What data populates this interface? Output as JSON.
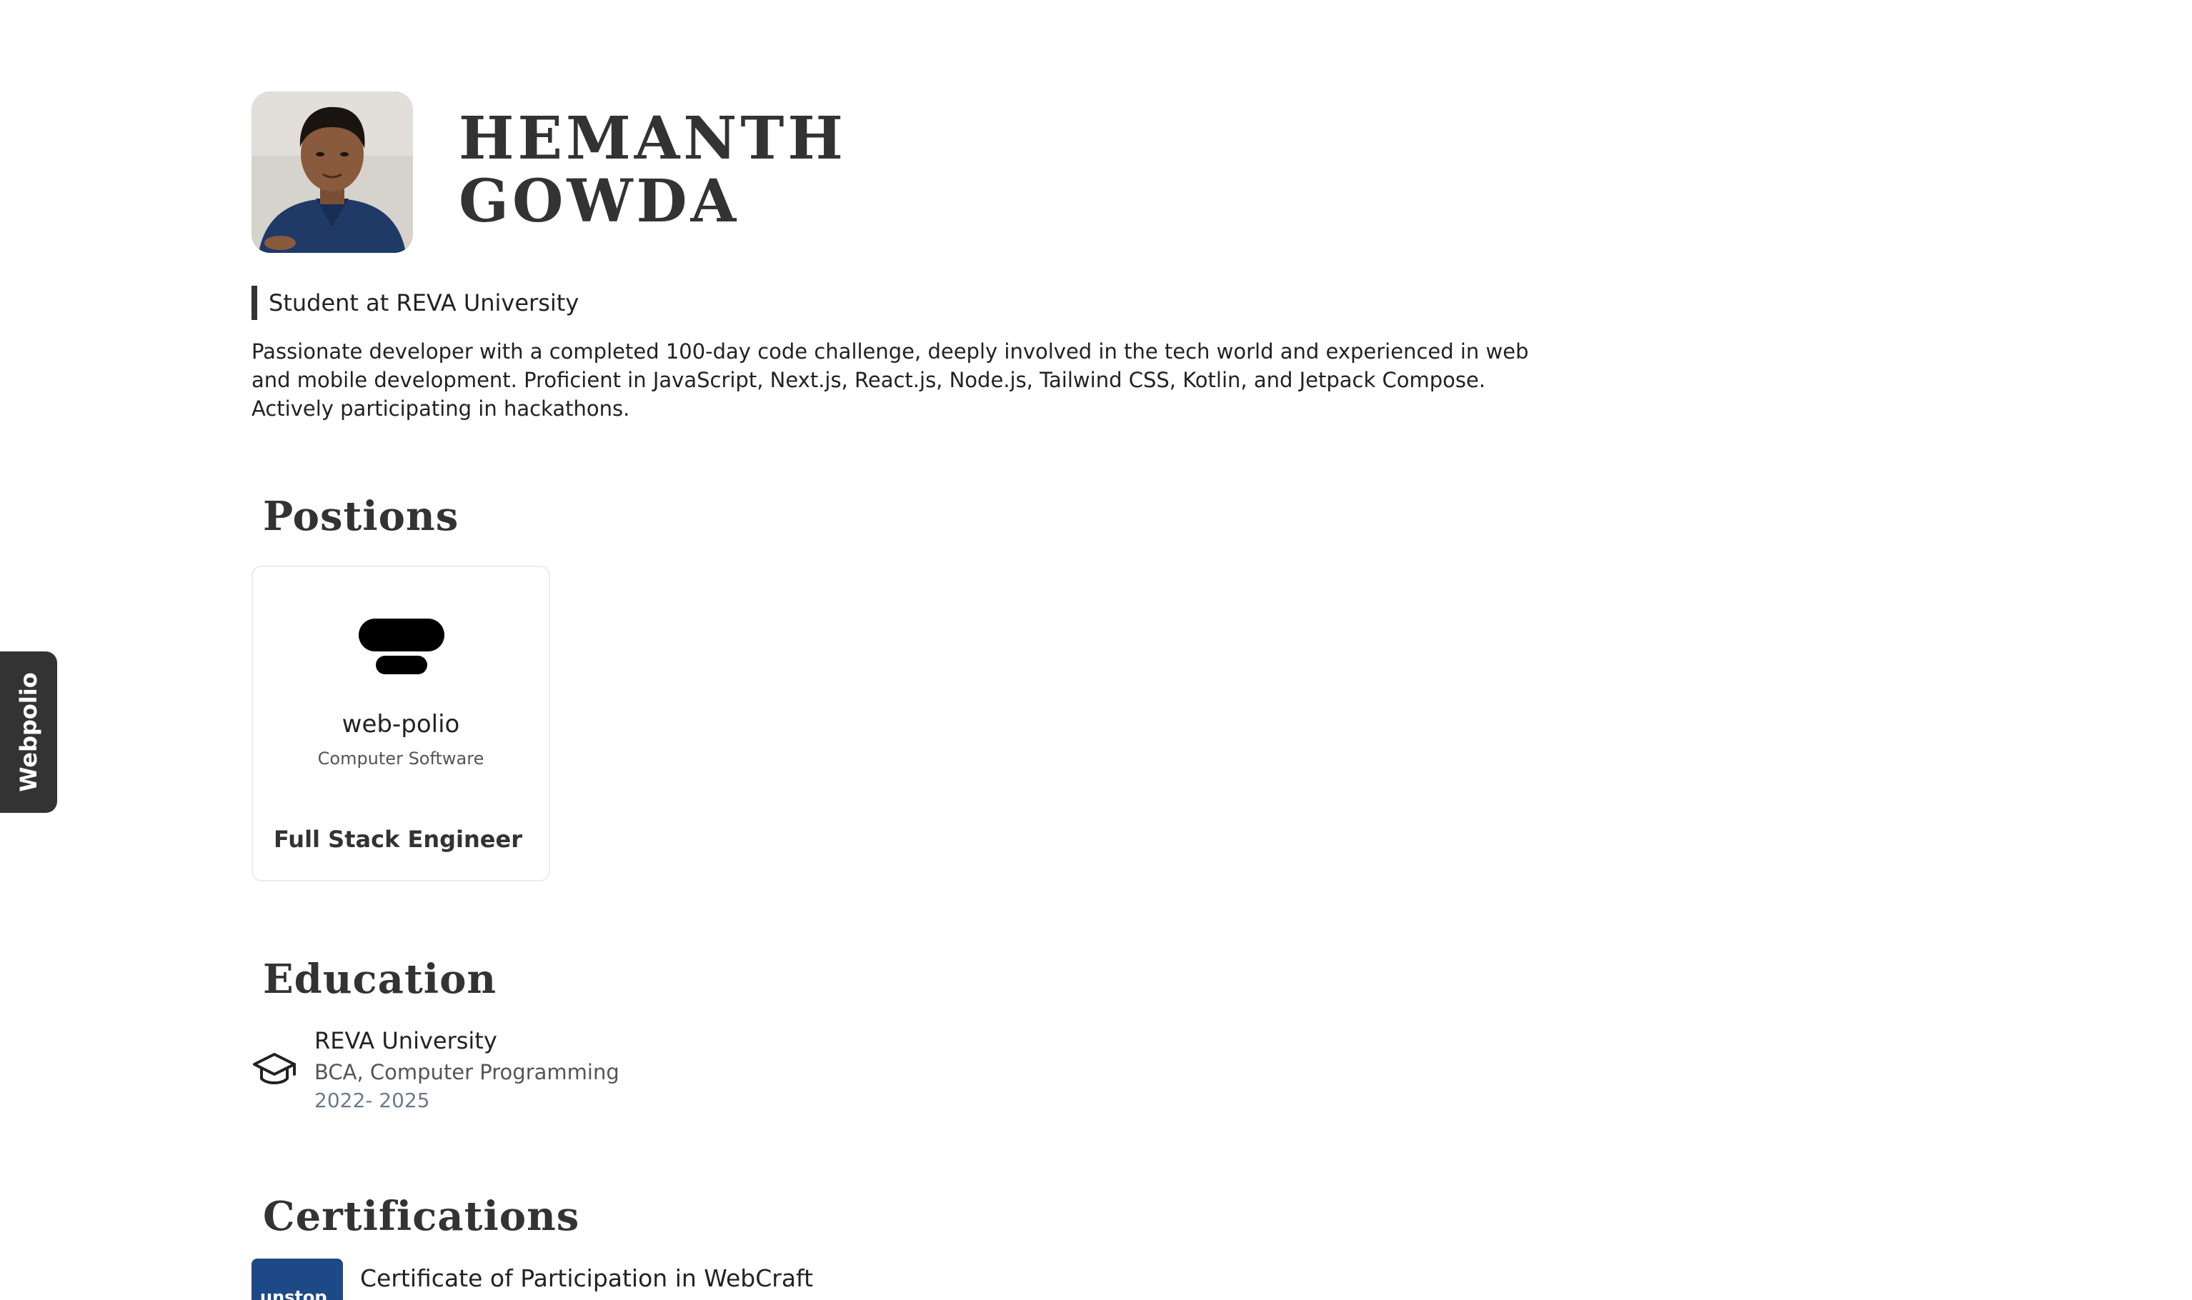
{
  "side_tab": {
    "label": "Webpolio"
  },
  "profile": {
    "name_line1": "HEMANTH",
    "name_line2": "GOWDA",
    "headline": "Student at REVA University",
    "bio": "Passionate developer with a completed 100-day code challenge, deeply involved in the tech world and experienced in web and mobile development. Proficient in JavaScript, Next.js, React.js, Node.js, Tailwind CSS, Kotlin, and Jetpack Compose. Actively participating in hackathons."
  },
  "positions": {
    "title": "Postions",
    "items": [
      {
        "company": "web-polio",
        "industry": "Computer Software",
        "role": "Full Stack Engineer",
        "logo_icon": "web-polio-logo"
      }
    ]
  },
  "education": {
    "title": "Education",
    "items": [
      {
        "school": "REVA University",
        "degree": "BCA, Computer Programming",
        "years": "2022- 2025",
        "icon": "graduation-cap-icon"
      }
    ]
  },
  "certifications": {
    "title": "Certifications",
    "items": [
      {
        "title": "Certificate of Participation in WebCraft",
        "logo_text": "unstop"
      }
    ]
  },
  "colors": {
    "dark": "#333333",
    "text": "#222222",
    "muted": "#555555",
    "years": "#6b7a90",
    "cert_logo_bg": "#1d4a86"
  }
}
